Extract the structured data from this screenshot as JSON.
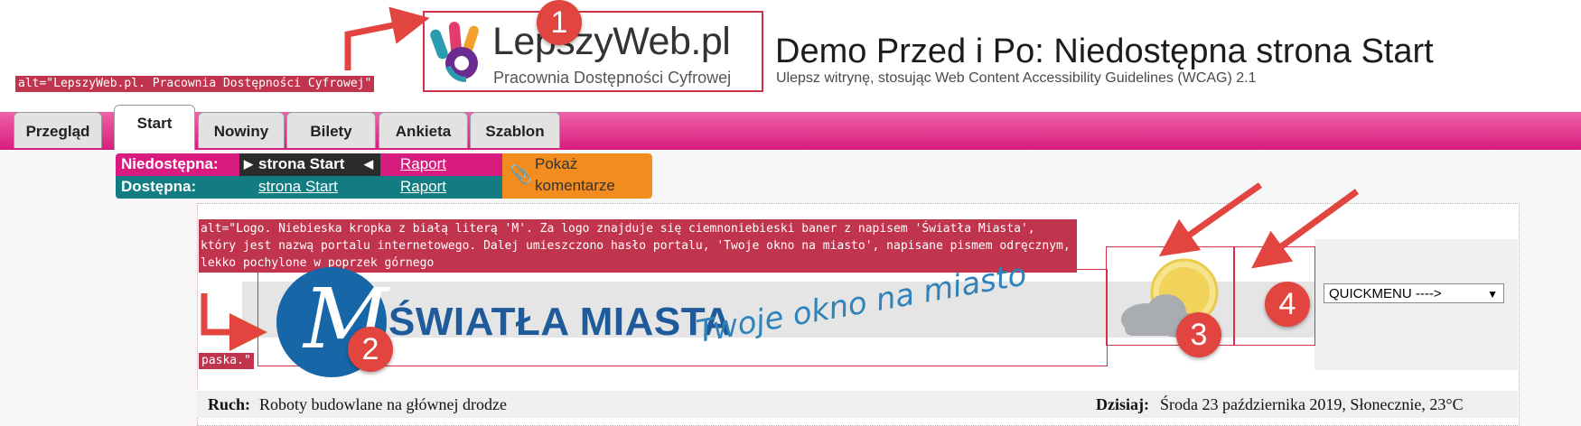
{
  "header": {
    "alt_text": "alt=\"LepszyWeb.pl. Pracownia Dostępności Cyfrowej\"",
    "logo_main": "LepszyWeb.pl",
    "logo_sub": "Pracownia Dostępności Cyfrowej",
    "title": "Demo Przed i Po: Niedostępna strona Start",
    "subtitle": "Ulepsz witrynę, stosując Web Content Accessibility Guidelines (WCAG) 2.1"
  },
  "badges": [
    "1",
    "2",
    "3",
    "4"
  ],
  "tabs": [
    "Przegląd",
    "Start",
    "Nowiny",
    "Bilety",
    "Ankieta",
    "Szablon"
  ],
  "subnav": {
    "inaccessible_label": "Niedostępna:",
    "accessible_label": "Dostępna:",
    "inaccessible_page": "strona Start",
    "accessible_page": "strona Start",
    "report": "Raport",
    "comments": "Pokaż komentarze"
  },
  "banner": {
    "alt_text": "alt=\"Logo. Niebieska kropka z białą literą 'M'. Za logo znajduje się ciemnoniebieski baner z napisem 'Światła Miasta', który jest nazwą portalu internetowego. Dalej umieszczono hasło portalu, 'Twoje okno na miasto', napisane pismem odręcznym, lekko pochylone w poprzek górnego",
    "alt_text_end": "paska.\"",
    "logo_letter": "M",
    "title": "ŚWIATŁA MIASTA",
    "slogan": "Twoje okno na miasto"
  },
  "quickmenu": {
    "selected": "QUICKMENU ---->"
  },
  "status": {
    "traffic_label": "Ruch:",
    "traffic_value": "Roboty budowlane na głównej drodze",
    "today_label": "Dzisiaj:",
    "today_value": "Środa 23 października 2019, Słonecznie, 23°C"
  },
  "colors": {
    "pink": "#d81b7e",
    "teal": "#137b82",
    "dark": "#2b2b2b",
    "orange": "#f38c1e",
    "annotation_red": "#e2453f"
  }
}
